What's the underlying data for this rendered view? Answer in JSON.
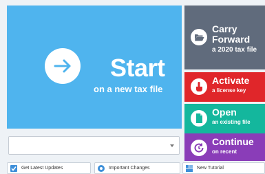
{
  "start_tile": {
    "title": "Start",
    "subtitle": "on a new tax file"
  },
  "carry_tile": {
    "line1": "Carry",
    "line2": "Forward",
    "line3": "a 2020 tax file"
  },
  "activate_tile": {
    "title": "Activate",
    "subtitle": "a license key"
  },
  "open_tile": {
    "title": "Open",
    "subtitle": "an existing file"
  },
  "continue_tile": {
    "title": "Continue",
    "subtitle": "on recent"
  },
  "dropdown": {
    "value": ""
  },
  "bottom_buttons": {
    "updates": "Get Latest Updates",
    "changes": "Important Changes",
    "tutorial": "New Tutorial"
  },
  "colors": {
    "start": "#4fb4ee",
    "carry": "#606b7c",
    "activate": "#e0262a",
    "open": "#14b79d",
    "continue": "#8a3db8"
  },
  "icons": {
    "start": "arrow-right-icon",
    "carry": "folder-open-icon",
    "activate": "hand-pointer-icon",
    "open": "file-icon",
    "continue": "clock-refresh-icon",
    "updates": "checkbox-icon",
    "changes": "info-icon",
    "tutorial": "tutorial-icon"
  }
}
